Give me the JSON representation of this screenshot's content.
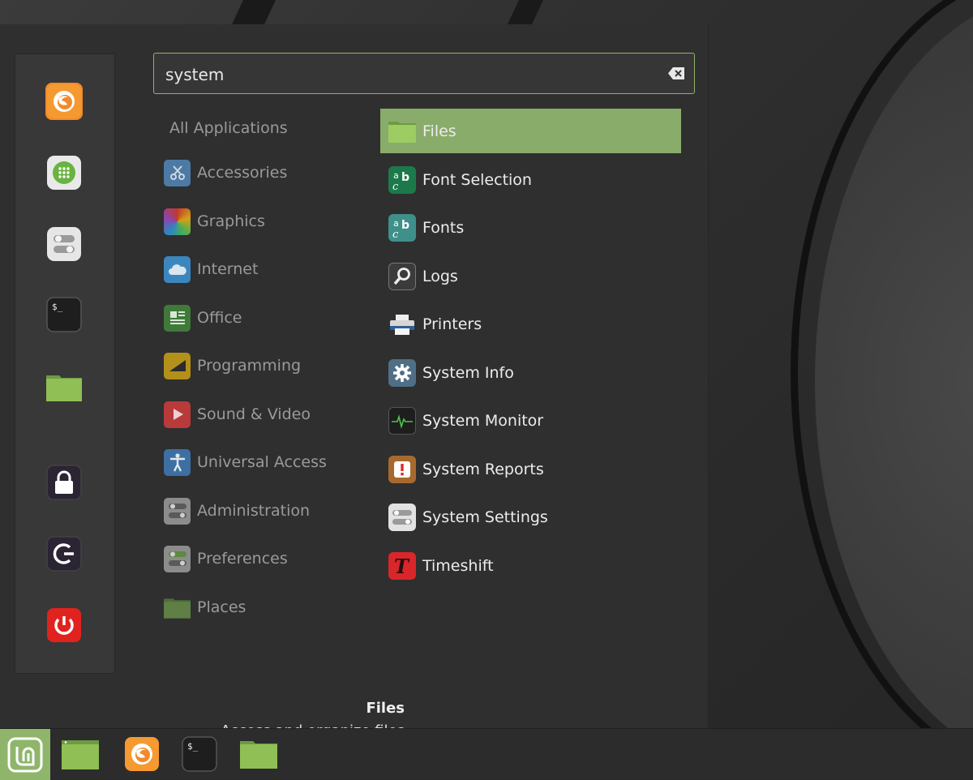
{
  "search": {
    "value": "system"
  },
  "categories": [
    {
      "label": "All Applications"
    },
    {
      "label": "Accessories"
    },
    {
      "label": "Graphics"
    },
    {
      "label": "Internet"
    },
    {
      "label": "Office"
    },
    {
      "label": "Programming"
    },
    {
      "label": "Sound & Video"
    },
    {
      "label": "Universal Access"
    },
    {
      "label": "Administration"
    },
    {
      "label": "Preferences"
    },
    {
      "label": "Places"
    }
  ],
  "apps": [
    {
      "label": "Files",
      "selected": true
    },
    {
      "label": "Font Selection"
    },
    {
      "label": "Fonts"
    },
    {
      "label": "Logs"
    },
    {
      "label": "Printers"
    },
    {
      "label": "System Info"
    },
    {
      "label": "System Monitor"
    },
    {
      "label": "System Reports"
    },
    {
      "label": "System Settings"
    },
    {
      "label": "Timeshift"
    }
  ],
  "favorites": [
    {
      "icon": "firefox-icon"
    },
    {
      "icon": "software-manager-icon"
    },
    {
      "icon": "system-settings-icon"
    },
    {
      "icon": "terminal-icon"
    },
    {
      "icon": "files-icon"
    },
    {
      "icon": "lock-screen-icon"
    },
    {
      "icon": "logout-icon"
    },
    {
      "icon": "power-icon"
    }
  ],
  "description": {
    "title": "Files",
    "text": "Access and organize files"
  },
  "colors": {
    "accent": "#8fb56b",
    "selected": "#8aac6a",
    "panel": "#2f2f2f"
  }
}
